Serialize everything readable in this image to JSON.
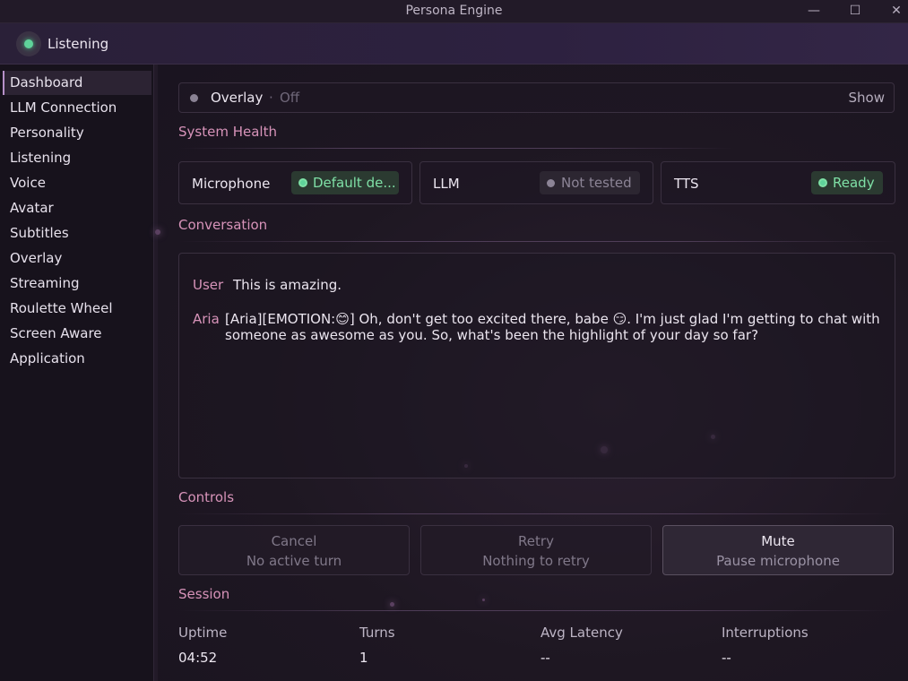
{
  "window": {
    "title": "Persona Engine",
    "minimize_glyph": "—",
    "maximize_glyph": "☐",
    "close_glyph": "✕"
  },
  "status": {
    "label": "Listening",
    "color": "#5fd39a"
  },
  "sidebar": {
    "items": [
      {
        "label": "Dashboard",
        "active": true
      },
      {
        "label": "LLM Connection"
      },
      {
        "label": "Personality"
      },
      {
        "label": "Listening"
      },
      {
        "label": "Voice"
      },
      {
        "label": "Avatar"
      },
      {
        "label": "Subtitles"
      },
      {
        "label": "Overlay"
      },
      {
        "label": "Streaming"
      },
      {
        "label": "Roulette Wheel"
      },
      {
        "label": "Screen Aware"
      },
      {
        "label": "Application"
      }
    ]
  },
  "overlay": {
    "name": "Overlay",
    "separator": "·",
    "state": "Off",
    "action": "Show"
  },
  "system_health": {
    "title": "System Health",
    "items": [
      {
        "name": "Microphone",
        "status": "Default de...",
        "state": "ok"
      },
      {
        "name": "LLM",
        "status": "Not tested",
        "state": "muted"
      },
      {
        "name": "TTS",
        "status": "Ready",
        "state": "ok"
      }
    ]
  },
  "conversation": {
    "title": "Conversation",
    "messages": [
      {
        "role": "User",
        "text": "This is amazing."
      },
      {
        "role": "Aria",
        "line1": "[Aria][EMOTION:😊] Oh, don't get too excited there, babe 😏. I'm just glad I'm getting to chat with",
        "line2": "someone as awesome as you. So, what's been the highlight of your day so far?"
      }
    ]
  },
  "controls": {
    "title": "Controls",
    "buttons": [
      {
        "label": "Cancel",
        "sub": "No active turn",
        "enabled": false
      },
      {
        "label": "Retry",
        "sub": "Nothing to retry",
        "enabled": false
      },
      {
        "label": "Mute",
        "sub": "Pause microphone",
        "enabled": true
      }
    ]
  },
  "session": {
    "title": "Session",
    "stats": [
      {
        "label": "Uptime",
        "value": "04:52"
      },
      {
        "label": "Turns",
        "value": "1"
      },
      {
        "label": "Avg Latency",
        "value": "--"
      },
      {
        "label": "Interruptions",
        "value": "--"
      }
    ]
  },
  "colors": {
    "accent": "#d793b9",
    "ok": "#7fe0a6",
    "background": "#1a1420"
  }
}
